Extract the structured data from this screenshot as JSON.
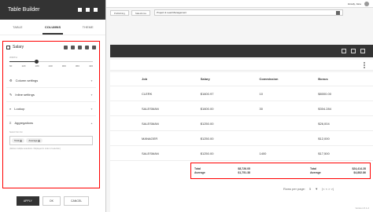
{
  "app": {
    "user": "Howdy, Jane",
    "nav": [
      "Publishing",
      "Salesforce",
      "Project & Lead Management"
    ],
    "version": "Version 6.1.2"
  },
  "sidebar": {
    "title": "Table Builder",
    "tabs": [
      "Table",
      "Columns",
      "Theme"
    ],
    "column_name": "Salary",
    "slider_label": "WIDTH",
    "slider_ticks": [
      "60",
      "120",
      "180",
      "240",
      "300",
      "360",
      "420"
    ],
    "accordions": [
      "Column settings",
      "Inline settings",
      "Lookup",
      "Aggregations"
    ],
    "aggregations": {
      "label": "Select from list",
      "chips": [
        "Total",
        "Average"
      ],
      "help": "(Allows multiple selections. Displayed in order of selection)"
    },
    "buttons": {
      "apply": "APPLY",
      "ok": "OK",
      "cancel": "CANCEL"
    }
  },
  "grid": {
    "headers": [
      "Job",
      "Salary",
      "Commission",
      "Bonus"
    ],
    "rows": [
      [
        "CLERK",
        "$1600.97",
        "10",
        "$8000.00"
      ],
      [
        "SALESMAN",
        "$1600.00",
        "30",
        "$304.284"
      ],
      [
        "SALESMAN",
        "$1250.00",
        "",
        "$26,004"
      ],
      [
        "MANAGER",
        "$1250.00",
        "",
        "$12,000"
      ],
      [
        "SALESMAN",
        "$1250.00",
        "1400",
        "$17,500"
      ]
    ],
    "totals": {
      "row1_label": "Total",
      "row1_sal": "$8,726.05",
      "row1_bonus_label": "Total",
      "row1_bonus": "$24,414.28",
      "row2_label": "Average",
      "row2_sal": "$1,751.38",
      "row2_bonus_label": "Average",
      "row2_bonus": "$4,882.86"
    },
    "pagination": {
      "label": "Rows per page:",
      "value": "5"
    }
  }
}
